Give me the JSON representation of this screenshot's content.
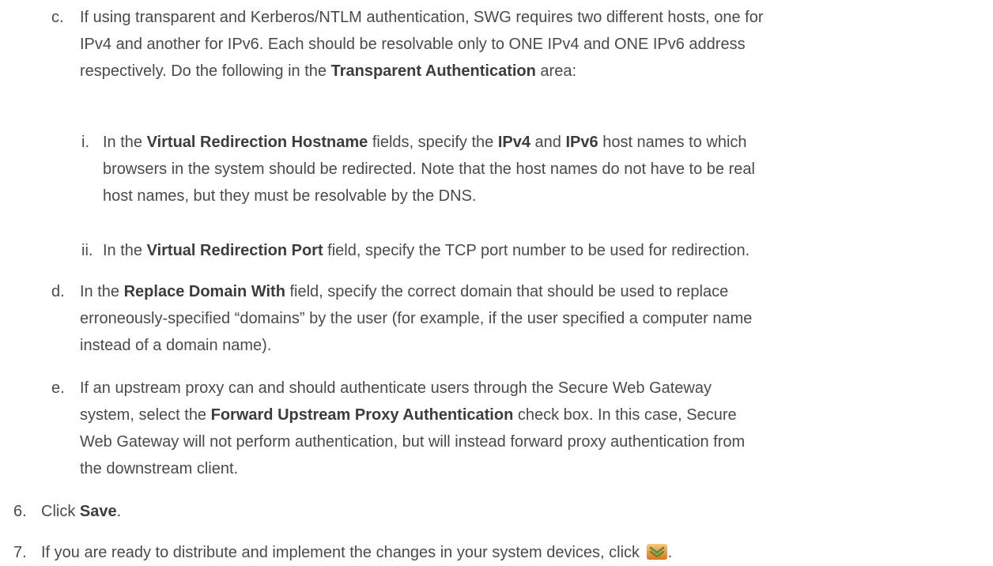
{
  "items": {
    "c": {
      "marker": "c.",
      "lines": [
        [
          {
            "t": "If using transparent and Kerberos/NTLM authentication, SWG requires two different hosts, one for"
          }
        ],
        [
          {
            "t": "IPv4 and another for IPv6. Each should be resolvable only to ONE IPv4 and ONE IPv6 address"
          }
        ],
        [
          {
            "t": "respectively. Do the following in the "
          },
          {
            "t": "Transparent Authentication",
            "b": true
          },
          {
            "t": " area:"
          }
        ]
      ]
    },
    "c_i": {
      "marker": "i.",
      "lines": [
        [
          {
            "t": "In the "
          },
          {
            "t": "Virtual Redirection Hostname",
            "b": true
          },
          {
            "t": " fields, specify the "
          },
          {
            "t": "IPv4",
            "b": true
          },
          {
            "t": " and "
          },
          {
            "t": "IPv6",
            "b": true
          },
          {
            "t": " host names to which"
          }
        ],
        [
          {
            "t": "browsers in the system should be redirected. Note that the host names do not have to be real"
          }
        ],
        [
          {
            "t": "host names, but they must be resolvable by the DNS."
          }
        ]
      ]
    },
    "c_ii": {
      "marker": "ii.",
      "lines": [
        [
          {
            "t": "In the "
          },
          {
            "t": "Virtual Redirection Port",
            "b": true
          },
          {
            "t": " field, specify the TCP port number to be used for redirection."
          }
        ]
      ]
    },
    "d": {
      "marker": "d.",
      "lines": [
        [
          {
            "t": "In the "
          },
          {
            "t": "Replace Domain With",
            "b": true
          },
          {
            "t": " field, specify the correct domain that should be used to replace"
          }
        ],
        [
          {
            "t": "erroneously-specified “domains” by the user (for example, if the user specified a computer name"
          }
        ],
        [
          {
            "t": "instead of a domain name)."
          }
        ]
      ]
    },
    "e": {
      "marker": "e.",
      "lines": [
        [
          {
            "t": "If an upstream proxy can and should authenticate users through the Secure Web Gateway"
          }
        ],
        [
          {
            "t": "system, select the "
          },
          {
            "t": "Forward Upstream Proxy Authentication",
            "b": true
          },
          {
            "t": " check box. In this case, Secure"
          }
        ],
        [
          {
            "t": "Web Gateway will not perform authentication, but will instead forward proxy authentication from"
          }
        ],
        [
          {
            "t": "the downstream client."
          }
        ]
      ]
    },
    "step6": {
      "marker": "6.",
      "lines": [
        [
          {
            "t": "Click "
          },
          {
            "t": "Save",
            "b": true
          },
          {
            "t": "."
          }
        ]
      ]
    },
    "step7": {
      "marker": "7.",
      "lines": [
        [
          {
            "t": "If you are ready to distribute and implement the changes in your system devices, click "
          },
          {
            "icon": "deploy-changes-icon"
          },
          {
            "t": "."
          }
        ]
      ]
    }
  },
  "colors": {
    "text": "#4a4a4a",
    "icon_gradient_top": "#f7c97a",
    "icon_gradient_bottom": "#d9761f",
    "icon_chevron": "#5a8a3a"
  }
}
